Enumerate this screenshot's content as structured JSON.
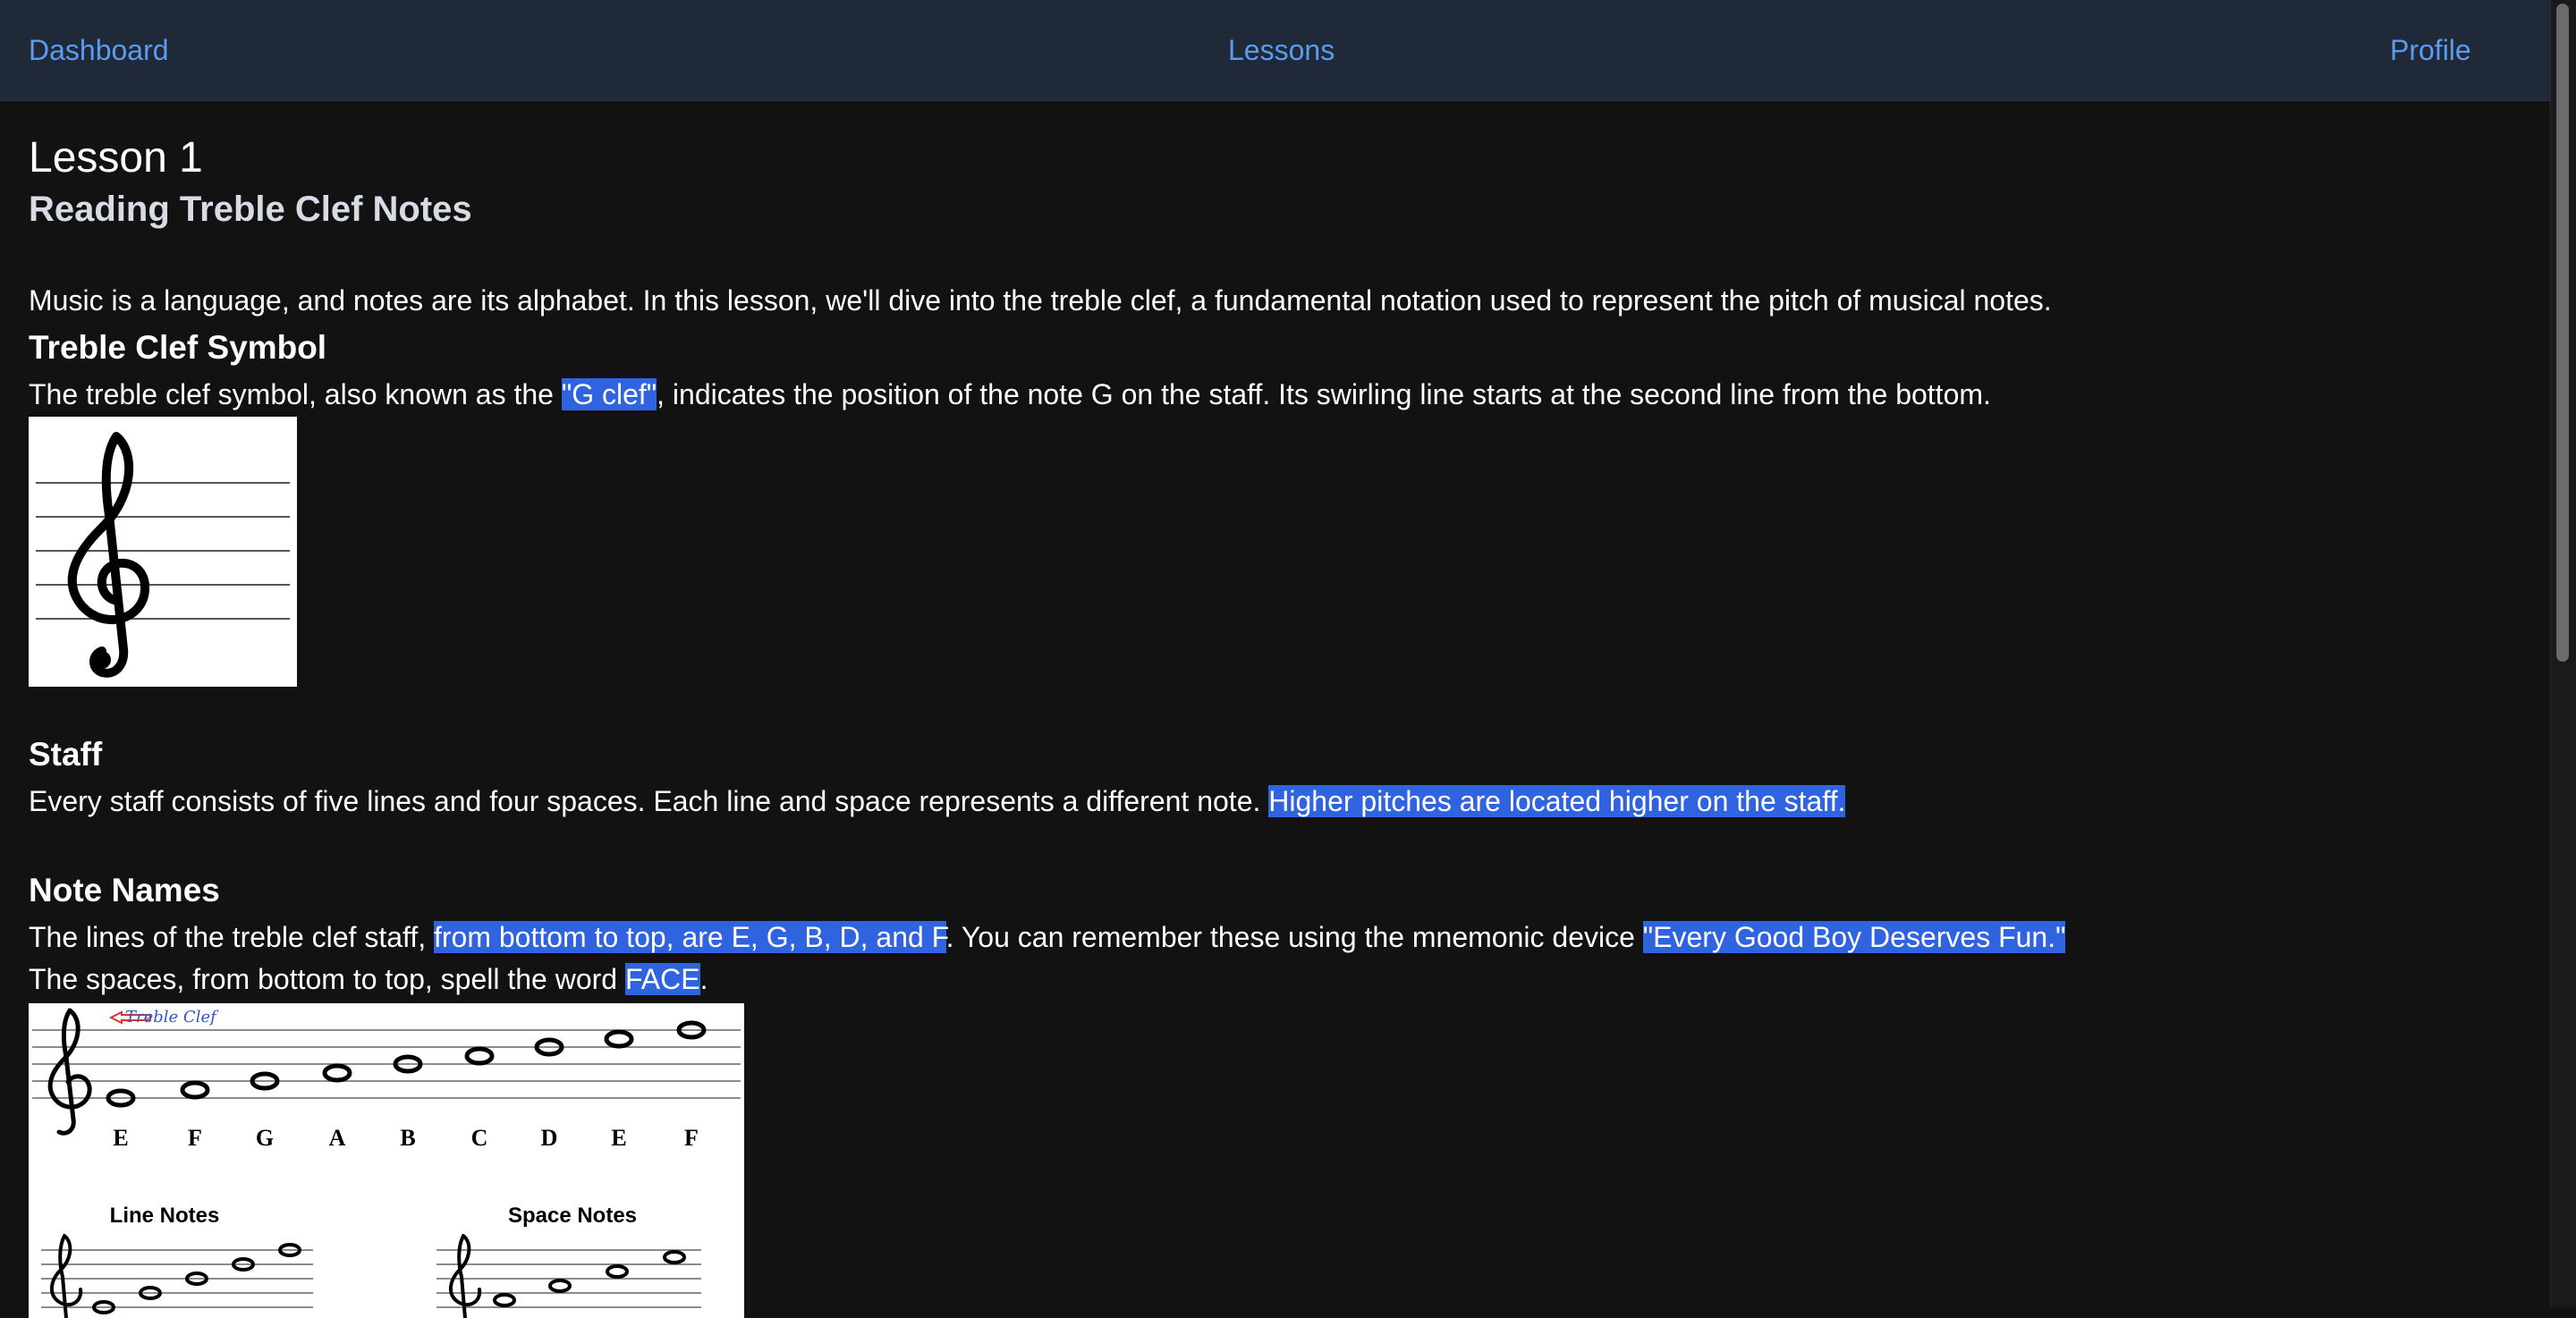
{
  "nav": {
    "dashboard": "Dashboard",
    "lessons": "Lessons",
    "profile": "Profile"
  },
  "lesson": {
    "number": "Lesson 1",
    "subtitle": "Reading Treble Clef Notes",
    "intro": "Music is a language, and notes are its alphabet. In this lesson, we'll dive into the treble clef, a fundamental notation used to represent the pitch of musical notes.",
    "clef_section": {
      "heading": "Treble Clef Symbol",
      "text_before": "The treble clef symbol, also known as the ",
      "highlight": "\"G clef\"",
      "text_after": ", indicates the position of the note G on the staff. Its swirling line starts at the second line from the bottom."
    },
    "staff_section": {
      "heading": "Staff",
      "text_before": "Every staff consists of five lines and four spaces. Each line and space represents a different note. ",
      "highlight": "Higher pitches are located higher on the staff."
    },
    "names_section": {
      "heading": "Note Names",
      "line1_before": "The lines of the treble clef staff, ",
      "line1_highlight1": "from bottom to top, are E, G, B, D, and F",
      "line1_middle": ". You can remember these using the mnemonic device ",
      "line1_highlight2": "\"Every Good Boy Deserves Fun.\"",
      "line2_before": "The spaces, from bottom to top, spell the word ",
      "line2_highlight": "FACE",
      "line2_after": "."
    }
  },
  "diagram": {
    "clef_label": "Treble Clef",
    "note_letters": [
      "E",
      "F",
      "G",
      "A",
      "B",
      "C",
      "D",
      "E",
      "F"
    ],
    "line_notes_label": "Line Notes",
    "space_notes_label": "Space Notes"
  },
  "colors": {
    "background": "#121212",
    "nav_bg": "#1f2937",
    "nav_link": "#5b9cf0",
    "highlight": "#2f63e0"
  }
}
